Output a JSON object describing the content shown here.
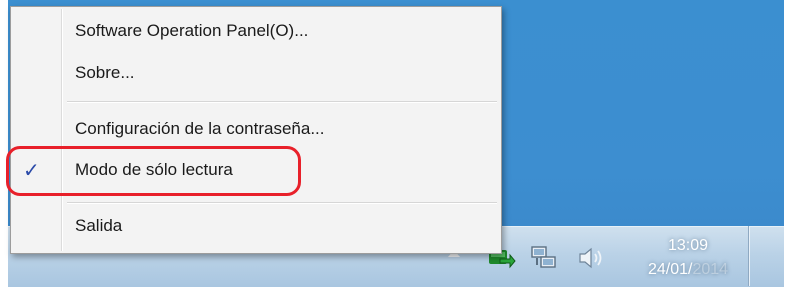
{
  "menu": {
    "items": [
      {
        "label": "Software Operation Panel(O)..."
      },
      {
        "label": "Sobre..."
      },
      {
        "label": "Configuración de la contraseña..."
      },
      {
        "label": "Modo de sólo lectura",
        "checked": true,
        "check_glyph": "✓"
      },
      {
        "label": "Salida"
      }
    ]
  },
  "tray": {
    "icons": [
      "show-hidden-icons-arrow",
      "scanner-status-icon",
      "network-icon",
      "volume-icon"
    ],
    "clock": {
      "time": "13:09",
      "date_visible": "24/01/",
      "date_obscured": "2014"
    }
  },
  "colors": {
    "desktop": "#3b8fd0",
    "highlight_ring": "#e8202a",
    "check": "#2a4aa8"
  }
}
